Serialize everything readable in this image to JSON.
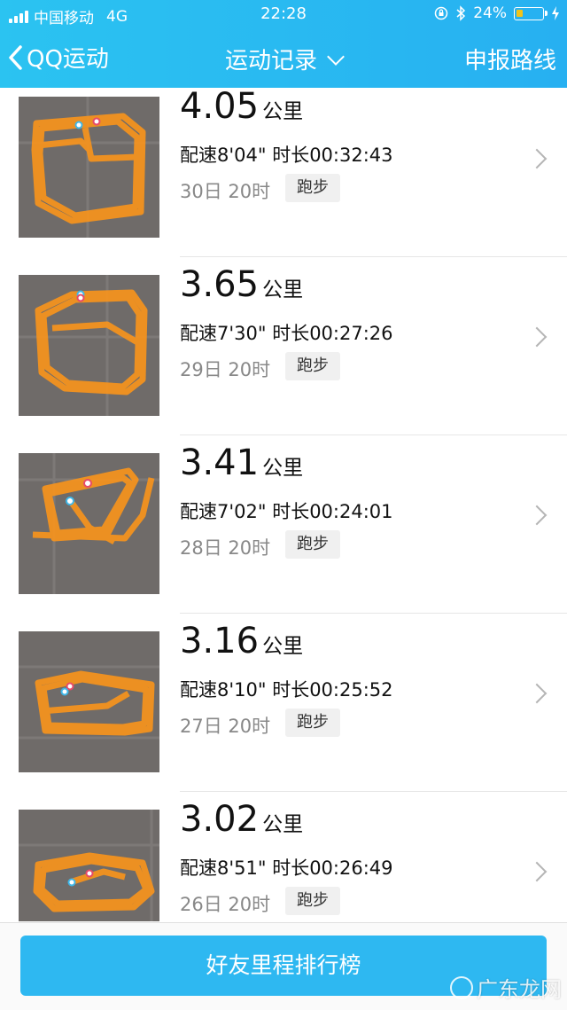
{
  "status_bar": {
    "carrier": "中国移动",
    "network": "4G",
    "time": "22:28",
    "battery": "24%",
    "battery_level": 0.24
  },
  "nav": {
    "back_label": "QQ运动",
    "title": "运动记录",
    "action": "申报路线"
  },
  "records": [
    {
      "distance": "4.05",
      "unit": "公里",
      "pace_duration": "配速8'04\" 时长00:32:43",
      "date": "30日 20时",
      "type": "跑步"
    },
    {
      "distance": "3.65",
      "unit": "公里",
      "pace_duration": "配速7'30\" 时长00:27:26",
      "date": "29日 20时",
      "type": "跑步"
    },
    {
      "distance": "3.41",
      "unit": "公里",
      "pace_duration": "配速7'02\" 时长00:24:01",
      "date": "28日 20时",
      "type": "跑步"
    },
    {
      "distance": "3.16",
      "unit": "公里",
      "pace_duration": "配速8'10\" 时长00:25:52",
      "date": "27日 20时",
      "type": "跑步"
    },
    {
      "distance": "3.02",
      "unit": "公里",
      "pace_duration": "配速8'51\" 时长00:26:49",
      "date": "26日 20时",
      "type": "跑步"
    }
  ],
  "footer": {
    "button_label": "好友里程排行榜"
  },
  "watermark": {
    "text": "广东龙网"
  },
  "colors": {
    "header": "#2bc3f1",
    "button": "#2eb8f1",
    "route": "#f7941d",
    "map_bg": "#6f6b69"
  }
}
